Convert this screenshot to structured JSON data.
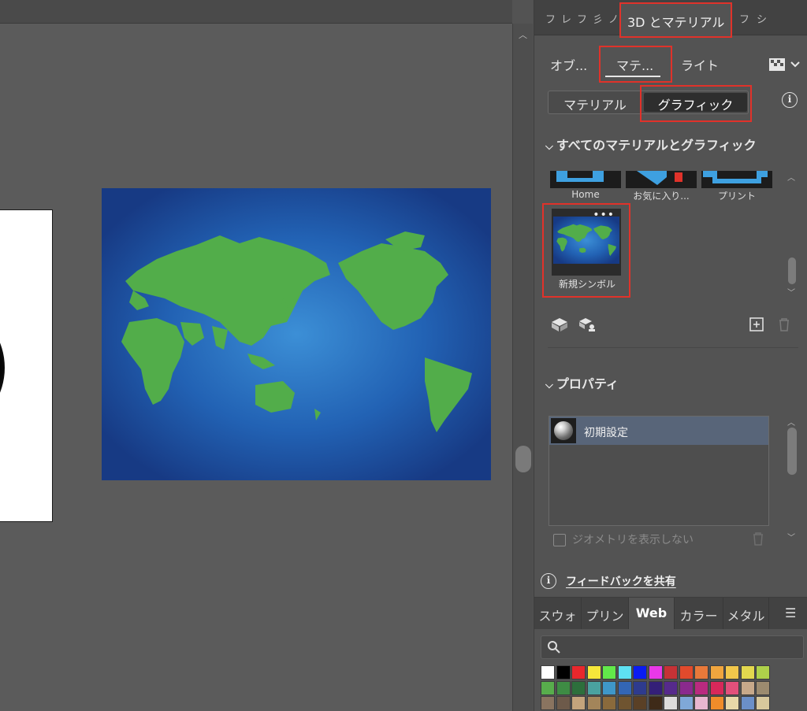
{
  "top_tabs": {
    "collapsed": [
      "フ",
      "レ",
      "フ",
      "彡",
      "ノ"
    ],
    "active": "3D とマテリアル",
    "overflow": "フ",
    "overflow2": "シ"
  },
  "sub_tabs": {
    "object": "オブ...",
    "material": "マテ...",
    "light": "ライト"
  },
  "segment": {
    "material": "マテリアル",
    "graphic": "グラフィック"
  },
  "section_all": "すべてのマテリアルとグラフィック",
  "library_thumbs": [
    "Home",
    "お気に入り...",
    "プリント"
  ],
  "symbol": {
    "name": "新規シンボル"
  },
  "section_properties": "プロパティ",
  "properties_list": [
    {
      "label": "初期設定"
    }
  ],
  "hide_geometry_label": "ジオメトリを表示しない",
  "feedback": "フィードバックを共有",
  "swatch_tabs": [
    "スウォ",
    "プリン",
    "Web",
    "カラー",
    "メタル"
  ],
  "swatch_active": "Web",
  "colors": {
    "accent_red": "#e0322a",
    "map_ocean": "#1f57a8",
    "map_land": "#52ad4a"
  },
  "swatch_row1": [
    "#ffffff",
    "#000000",
    "#e8272c",
    "#f6e73a",
    "#62e84a",
    "#5ee1f2",
    "#0a1cf2",
    "#e938e8",
    "#c53236",
    "#e14a2c",
    "#e8793a",
    "#f0a53e",
    "#f2c74b",
    "#e3d84e",
    "#aed14a"
  ],
  "swatch_row2": [
    "#58ad4c",
    "#3e8c44",
    "#2d6f3c",
    "#4aa2a0",
    "#3f97c9",
    "#3366b5",
    "#2e3b8e",
    "#341f78",
    "#562a8c",
    "#8a2a8d",
    "#b92a7f",
    "#d7285a",
    "#e2507b",
    "#c7a98a",
    "#9c8b6f"
  ],
  "swatch_row3": [
    "#8a7460",
    "#6d5a4a",
    "#c3a47c",
    "#a3855a",
    "#8a6a3c",
    "#6f5430",
    "#5a4026",
    "#3e2a18",
    "#dcdcdc",
    "#7fa8d8",
    "#e8b6cf",
    "#f08c2a",
    "#e8d8a8",
    "#6b8fc8",
    "#d8c89c"
  ]
}
